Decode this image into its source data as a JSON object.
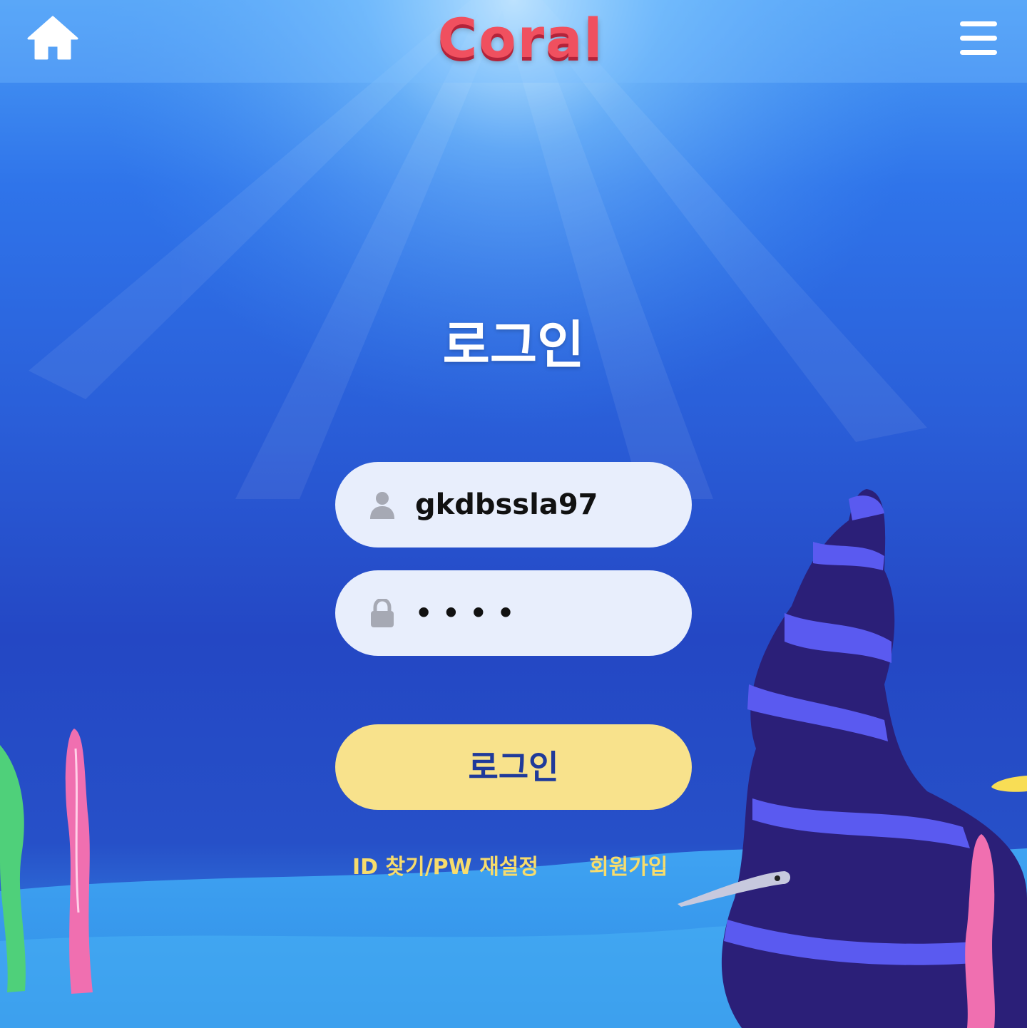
{
  "header": {
    "logo_text": "Coral",
    "home_icon": "home-icon",
    "menu_icon": "hamburger-menu-icon"
  },
  "login": {
    "title": "로그인",
    "username_value": "gkdbssla97",
    "password_value": "••••",
    "user_icon": "user-icon",
    "lock_icon": "lock-icon",
    "submit_label": "로그인",
    "find_link": "ID 찾기/PW 재설정",
    "signup_link": "회원가입"
  },
  "colors": {
    "logo": "#f0505f",
    "input_bg": "#e8eefc",
    "button_bg": "#f8e28c",
    "button_text": "#1f3a9a",
    "link_text": "#f7dc6c"
  }
}
